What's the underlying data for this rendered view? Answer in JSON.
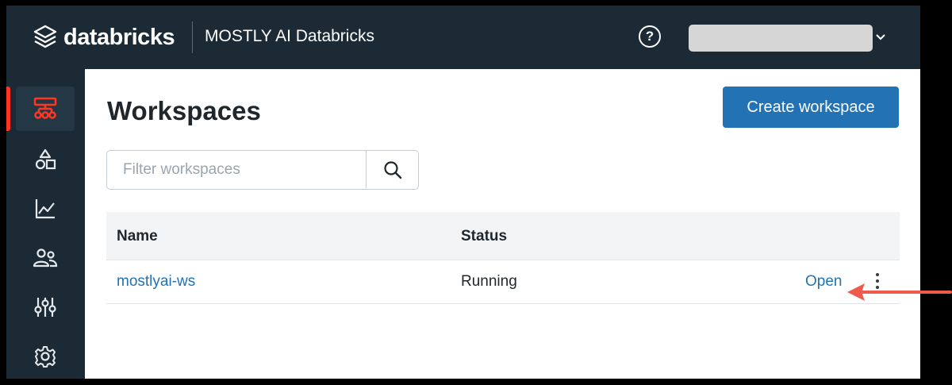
{
  "brand": {
    "logo_text": "databricks"
  },
  "topbar": {
    "workspace_name": "MOSTLY AI Databricks",
    "help_symbol": "?",
    "user_menu": {
      "redacted": true,
      "icon": "chevron-down-icon"
    }
  },
  "sidebar": {
    "items": [
      {
        "icon": "workspaces-icon",
        "active": true
      },
      {
        "icon": "shapes-icon",
        "active": false
      },
      {
        "icon": "chart-icon",
        "active": false
      },
      {
        "icon": "users-icon",
        "active": false
      },
      {
        "icon": "sliders-icon",
        "active": false
      },
      {
        "icon": "gear-icon",
        "active": false
      }
    ]
  },
  "main": {
    "title": "Workspaces",
    "create_button": "Create workspace",
    "filter": {
      "placeholder": "Filter workspaces",
      "value": "",
      "icon": "search-icon"
    },
    "table": {
      "columns": [
        "Name",
        "Status"
      ],
      "rows": [
        {
          "name": "mostlyai-ws",
          "status": "Running",
          "action": "Open"
        }
      ]
    }
  },
  "colors": {
    "topbar": "#1b2a35",
    "accent_blue": "#2272b4",
    "active_red": "#ff3621",
    "annotation_arrow": "#ef5a4c"
  }
}
